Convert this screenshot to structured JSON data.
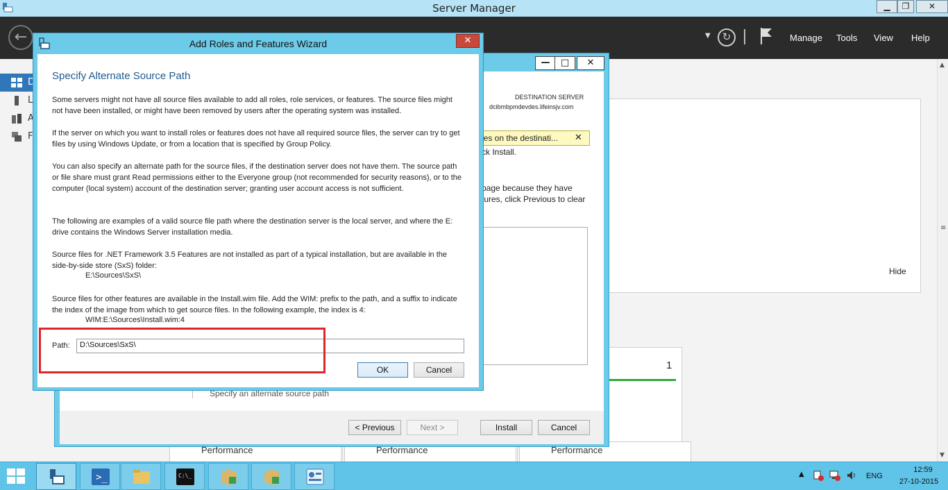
{
  "server_manager": {
    "title": "Server Manager",
    "window_buttons": {
      "minimize": "▁",
      "maximize": "❐",
      "close": "✕"
    },
    "menu": {
      "manage": "Manage",
      "tools": "Tools",
      "view": "View",
      "help": "Help"
    },
    "sidebar_letters": [
      "D",
      "L",
      "A",
      "F"
    ],
    "hide_link": "Hide",
    "tile_count": "1",
    "performance_label": "Performance",
    "icons": [
      "back-arrow-icon",
      "refresh-icon",
      "flag-icon",
      "dashboard-icon",
      "local-server-icon",
      "all-servers-icon",
      "file-storage-icon"
    ]
  },
  "background_wizard": {
    "window_buttons": {
      "minimize": "—",
      "maximize": "□",
      "close": "✕"
    },
    "destination_label": "DESTINATION SERVER",
    "destination_server": "dcibmbpmdevdes.lifeinsjv.com",
    "warning_text": "les on the destinati...",
    "warning_close": "✕",
    "partial_text_1": "ck Install.",
    "partial_text_2": "page because they have",
    "partial_text_3": "tures, click Previous to clear",
    "step_link": "Specify an alternate source path",
    "buttons": {
      "previous": "< Previous",
      "next": "Next >",
      "install": "Install",
      "cancel": "Cancel"
    }
  },
  "dialog": {
    "title": "Add Roles and Features Wizard",
    "close": "✕",
    "heading": "Specify Alternate Source Path",
    "paragraphs": {
      "p1": "Some servers might not have all source files available to add all roles, role services, or features. The source files might not have been installed, or might have been removed by users after the operating system was installed.",
      "p2": "If the server on which you want to install roles or features does not have all required source files, the server can try to get files by using Windows Update, or from a location that is specified by Group Policy.",
      "p3": "You can also specify an alternate path for the source files, if the destination server does not have them. The source path or file share must grant Read permissions either to the Everyone group (not recommended for security reasons), or to the computer (local system) account of the destination server; granting user account access is not sufficient.",
      "p4": "The following are examples of a valid source file path where the destination server is the local server, and where the E: drive contains the Windows Server installation media.",
      "p5": "Source files for .NET Framework 3.5 Features are not installed as part of a typical installation, but are available in the side-by-side store (SxS) folder:",
      "p5_example": "E:\\Sources\\SxS\\",
      "p6": "Source files for other features are available in the Install.wim file. Add the WIM: prefix to the path, and a suffix to indicate the index of the image from which to get source files. In the following example, the index is 4:",
      "p6_example": "WIM:E:\\Sources\\Install.wim:4"
    },
    "path_label": "Path:",
    "path_value": "D:\\Sources\\SxS\\",
    "ok": "OK",
    "cancel": "Cancel"
  },
  "taskbar": {
    "language": "ENG",
    "time": "12:59",
    "date": "27-10-2015",
    "tray_arrow": "▲"
  }
}
